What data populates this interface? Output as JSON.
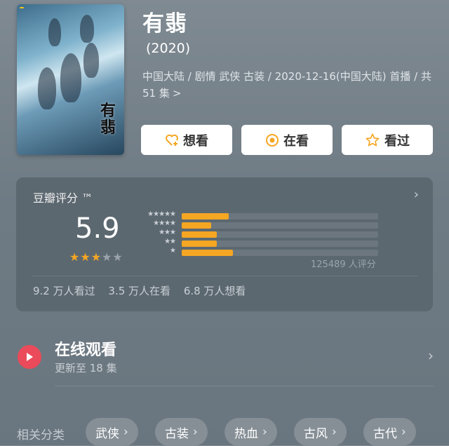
{
  "show": {
    "title": "有翡",
    "year": "(2020)",
    "meta_line": "中国大陆 / 剧情 武侠 古装 / 2020-12-16(中国大陆) 首播 / 共 51 集",
    "meta_chevron": ">",
    "poster_title": "有翡"
  },
  "actions": [
    {
      "label": "想看",
      "icon": "heart-plus-icon"
    },
    {
      "label": "在看",
      "icon": "target-icon"
    },
    {
      "label": "看过",
      "icon": "star-outline-icon"
    }
  ],
  "rating": {
    "label": "豆瓣评分 ™",
    "score": "5.9",
    "stars_filled": 3,
    "stars_total": 5,
    "count_text": "125489 人评分",
    "distribution": [
      {
        "stars": "★★★★★",
        "percent": 24
      },
      {
        "stars": "★★★★",
        "percent": 15
      },
      {
        "stars": "★★★",
        "percent": 18
      },
      {
        "stars": "★★",
        "percent": 18
      },
      {
        "stars": "★",
        "percent": 26
      }
    ],
    "stats": {
      "watched": "9.2 万人看过",
      "watching": "3.5 万人在看",
      "want": "6.8 万人想看"
    }
  },
  "watch_online": {
    "title": "在线观看",
    "subtitle": "更新至 18 集"
  },
  "related": {
    "label": "相关分类",
    "chips": [
      "武侠",
      "古装",
      "热血",
      "古风",
      "古代"
    ]
  },
  "colors": {
    "accent_bar": "#f5a623",
    "play_red": "#ea4a5a",
    "star_yellow": "#f5a623"
  }
}
